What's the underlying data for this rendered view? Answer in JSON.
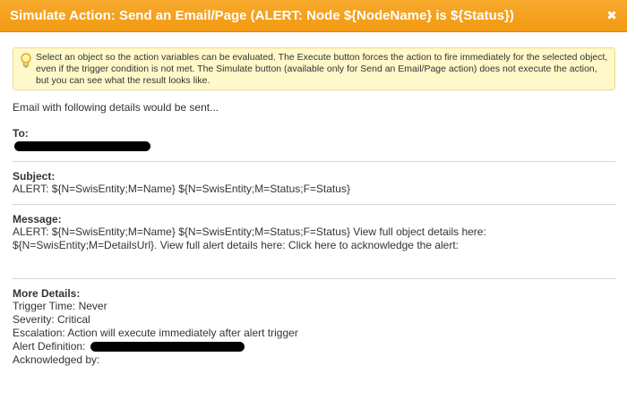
{
  "dialog": {
    "title": "Simulate Action: Send an Email/Page (ALERT: Node ${NodeName} is ${Status})",
    "close_glyph": "✖"
  },
  "info": {
    "icon": "lightbulb-icon",
    "text": "Select an object so the action variables can be evaluated. The Execute button forces the action to fire immediately for the selected object, even if the trigger condition is not met. The Simulate button (available only for Send an Email/Page action) does not execute the action, but you can see what the result looks like."
  },
  "intro": "Email with following details would be sent...",
  "to": {
    "label": "To:",
    "value_redacted": true
  },
  "subject": {
    "label": "Subject:",
    "value": "ALERT: ${N=SwisEntity;M=Name} ${N=SwisEntity;M=Status;F=Status}"
  },
  "message": {
    "label": "Message:",
    "value": "ALERT: ${N=SwisEntity;M=Name} ${N=SwisEntity;M=Status;F=Status} View full object details here: ${N=SwisEntity;M=DetailsUrl}. View full alert details here: Click here to acknowledge the alert:"
  },
  "more_details": {
    "label": "More Details:",
    "trigger_time": "Trigger Time: Never",
    "severity": "Severity: Critical",
    "escalation": "Escalation: Action will execute immediately after alert trigger",
    "alert_definition": "Alert Definition:",
    "acknowledged_by": "Acknowledged by:"
  },
  "colors": {
    "titlebar": "#f29a12",
    "info_bg": "#fff8c9",
    "info_border": "#eed98a",
    "redaction": "#000000"
  }
}
